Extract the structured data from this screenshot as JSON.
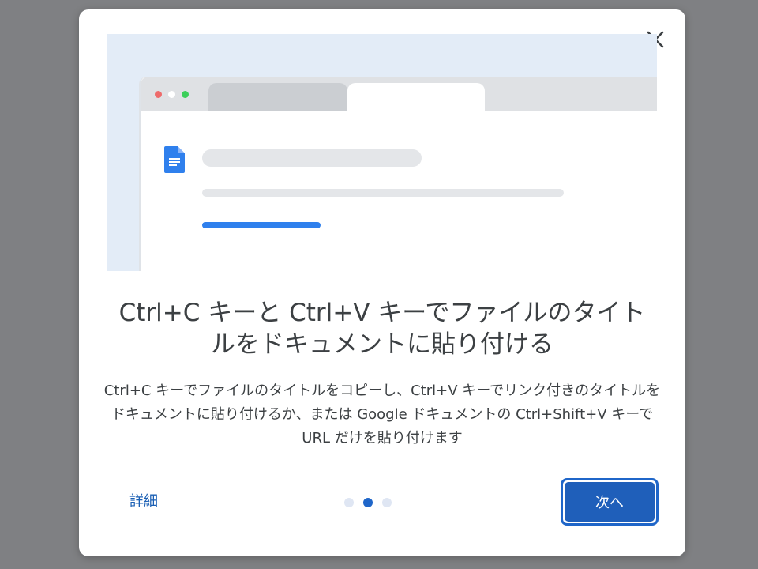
{
  "dialog": {
    "close_icon": "close-icon",
    "headline": "Ctrl+C キーと Ctrl+V キーでファイルのタイトルをドキュメントに貼り付ける",
    "body": "Ctrl+C キーでファイルのタイトルをコピーし、Ctrl+V キーでリンク付きのタイトルをドキュメントに貼り付けるか、または Google ドキュメントの Ctrl+Shift+V キーで URL だけを貼り付けます",
    "learn_more_label": "詳細",
    "next_label": "次へ",
    "pager": {
      "total": 3,
      "current": 2
    }
  },
  "illustration": {
    "doc_icon": "google-docs-icon",
    "window_dot_colors": [
      "#ee6b6b",
      "#dfe1e4",
      "#3ccf5a"
    ],
    "accent_line_color": "#2f80ed",
    "background_color": "#e3ecf7"
  }
}
